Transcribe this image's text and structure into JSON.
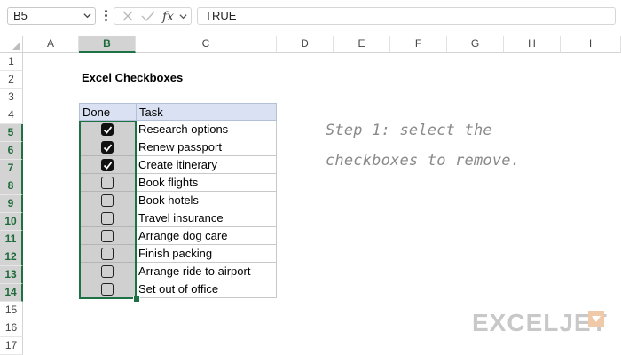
{
  "formula_bar": {
    "name_box": "B5",
    "fx_label": "fx",
    "formula": "TRUE"
  },
  "columns": [
    "A",
    "B",
    "C",
    "D",
    "E",
    "F",
    "G",
    "H",
    "I"
  ],
  "rows": [
    "1",
    "2",
    "3",
    "4",
    "5",
    "6",
    "7",
    "8",
    "9",
    "10",
    "11",
    "12",
    "13",
    "14",
    "15",
    "16",
    "17"
  ],
  "sheet": {
    "title": "Excel Checkboxes",
    "table": {
      "headers": {
        "done": "Done",
        "task": "Task"
      },
      "items": [
        {
          "task": "Research options",
          "done": true
        },
        {
          "task": "Renew passport",
          "done": true
        },
        {
          "task": "Create itinerary",
          "done": true
        },
        {
          "task": "Book flights",
          "done": false
        },
        {
          "task": "Book hotels",
          "done": false
        },
        {
          "task": "Travel insurance",
          "done": false
        },
        {
          "task": "Arrange dog care",
          "done": false
        },
        {
          "task": "Finish packing",
          "done": false
        },
        {
          "task": "Arrange ride to airport",
          "done": false
        },
        {
          "task": "Set out of office",
          "done": false
        }
      ]
    },
    "note_lines": [
      "Step 1: select the",
      "checkboxes to remove."
    ]
  },
  "logo": {
    "text": "EXCELJET"
  },
  "colors": {
    "accent": "#1e7145",
    "header_fill": "#d9e1f2",
    "selected_fill": "#d0d0d0"
  }
}
